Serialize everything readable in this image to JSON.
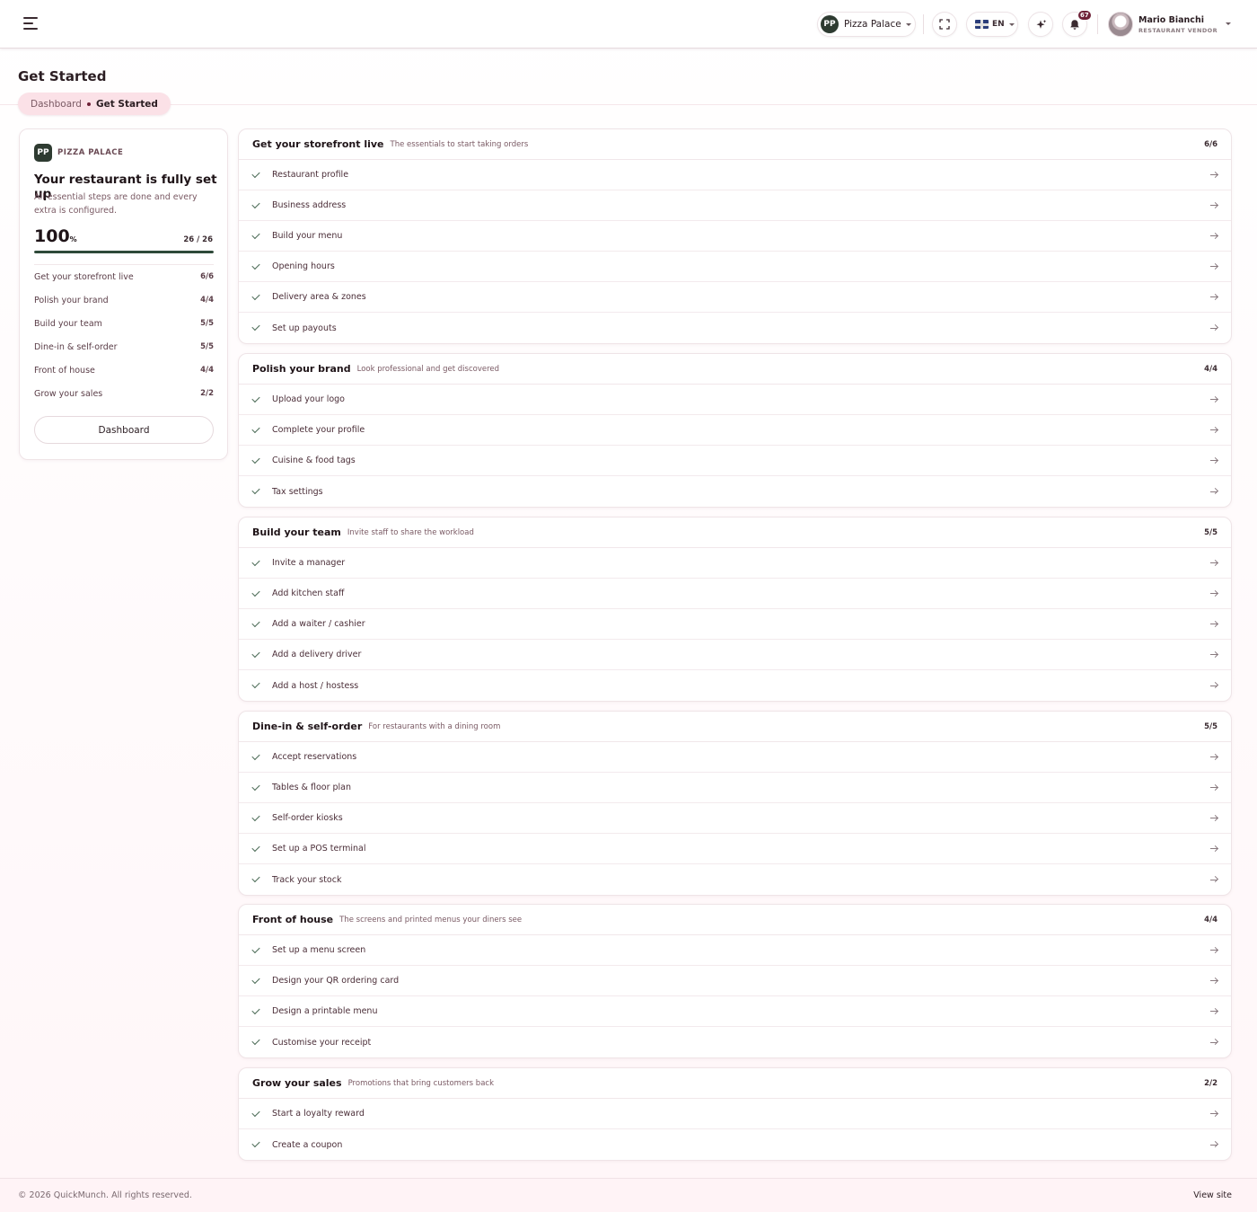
{
  "header": {
    "brand_logo_text": "PP",
    "brand_name": "Pizza Palace",
    "language": "EN",
    "notification_count": "67",
    "user": {
      "name": "Mario Bianchi",
      "role": "RESTAURANT VENDOR"
    },
    "icons": [
      "menu-icon",
      "fullscreen-icon",
      "uk-flag-icon",
      "sparkle-icon",
      "bell-icon",
      "avatar"
    ]
  },
  "page": {
    "title": "Get Started",
    "breadcrumb": {
      "link": "Dashboard",
      "current": "Get Started"
    }
  },
  "summary": {
    "brand_label": "PIZZA PALACE",
    "title": "Your restaurant is fully set up",
    "description": "All essential steps are done and every extra is configured.",
    "percent": "100",
    "percent_unit": "%",
    "progress": 1.0,
    "count": "26 / 26",
    "groups": [
      {
        "label": "Get your storefront live",
        "count": "6/6"
      },
      {
        "label": "Polish your brand",
        "count": "4/4"
      },
      {
        "label": "Build your team",
        "count": "5/5"
      },
      {
        "label": "Dine-in & self-order",
        "count": "5/5"
      },
      {
        "label": "Front of house",
        "count": "4/4"
      },
      {
        "label": "Grow your sales",
        "count": "2/2"
      }
    ],
    "button_label": "Dashboard"
  },
  "colors": {
    "accent": "#6e2137",
    "progress": "#2e4a39",
    "crumb_bg": "#fbe1e7"
  },
  "sections": [
    {
      "title": "Get your storefront live",
      "subtitle": "The essentials to start taking orders",
      "count": "6/6",
      "items": [
        "Restaurant profile",
        "Business address",
        "Build your menu",
        "Opening hours",
        "Delivery area & zones",
        "Set up payouts"
      ]
    },
    {
      "title": "Polish your brand",
      "subtitle": "Look professional and get discovered",
      "count": "4/4",
      "items": [
        "Upload your logo",
        "Complete your profile",
        "Cuisine & food tags",
        "Tax settings"
      ]
    },
    {
      "title": "Build your team",
      "subtitle": "Invite staff to share the workload",
      "count": "5/5",
      "items": [
        "Invite a manager",
        "Add kitchen staff",
        "Add a waiter / cashier",
        "Add a delivery driver",
        "Add a host / hostess"
      ]
    },
    {
      "title": "Dine-in & self-order",
      "subtitle": "For restaurants with a dining room",
      "count": "5/5",
      "items": [
        "Accept reservations",
        "Tables & floor plan",
        "Self-order kiosks",
        "Set up a POS terminal",
        "Track your stock"
      ]
    },
    {
      "title": "Front of house",
      "subtitle": "The screens and printed menus your diners see",
      "count": "4/4",
      "items": [
        "Set up a menu screen",
        "Design your QR ordering card",
        "Design a printable menu",
        "Customise your receipt"
      ]
    },
    {
      "title": "Grow your sales",
      "subtitle": "Promotions that bring customers back",
      "count": "2/2",
      "items": [
        "Start a loyalty reward",
        "Create a coupon"
      ]
    }
  ],
  "footer": {
    "copyright": "© 2026 QuickMunch. All rights reserved.",
    "view_site": "View site"
  }
}
